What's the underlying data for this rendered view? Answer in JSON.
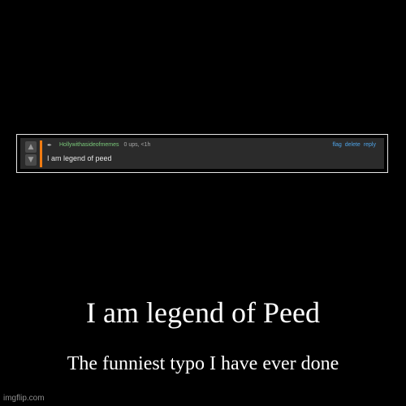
{
  "comment": {
    "username": "Hollywithasideofmemes",
    "stats": "0 ups, <1h",
    "actions": [
      "flag",
      "delete",
      "reply"
    ],
    "text": "I am legend of peed",
    "upvote_icon": "arrow-up-icon",
    "downvote_icon": "arrow-down-icon",
    "author_icon": "feather-icon",
    "accent_color": "#f07c13",
    "username_color": "#7ac87a",
    "link_color": "#4fa3e6"
  },
  "poster": {
    "title": "I am legend of Peed",
    "subtitle": "The funniest typo I have ever done"
  },
  "watermark": "imgflip.com"
}
